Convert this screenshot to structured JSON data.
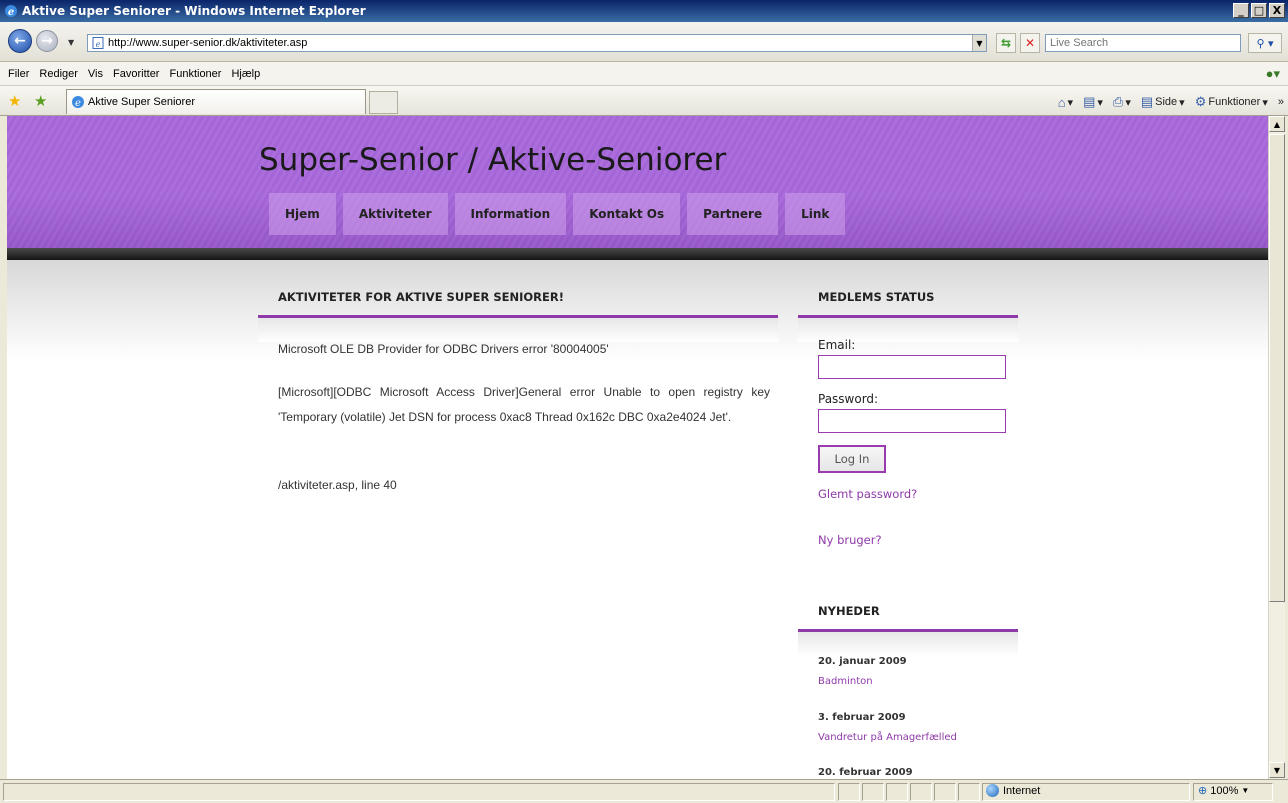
{
  "window": {
    "title": "Aktive Super Seniorer - Windows Internet Explorer",
    "minimize": "_",
    "maximize": "□",
    "close": "X"
  },
  "address": {
    "url": "http://www.super-senior.dk/aktiviteter.asp",
    "search_placeholder": "Live Search"
  },
  "menu": [
    "Filer",
    "Rediger",
    "Vis",
    "Favoritter",
    "Funktioner",
    "Hjælp"
  ],
  "tab": {
    "label": "Aktive Super Seniorer"
  },
  "toolbar": {
    "page_label": "Side",
    "tools_label": "Funktioner"
  },
  "site": {
    "title": "Super-Senior / Aktive-Seniorer",
    "nav": [
      "Hjem",
      "Aktiviteter",
      "Information",
      "Kontakt Os",
      "Partnere",
      "Link"
    ]
  },
  "main": {
    "heading": "AKTIVITETER FOR AKTIVE SUPER SENIORER!",
    "error_title": "Microsoft OLE DB Provider for ODBC Drivers error '80004005'",
    "error_detail": "[Microsoft][ODBC Microsoft Access Driver]General error Unable to open registry key 'Temporary (volatile) Jet DSN for process 0xac8 Thread 0x162c DBC 0xa2e4024 Jet'.",
    "error_location": "/aktiviteter.asp, line 40"
  },
  "sidebar": {
    "status_heading": "MEDLEMS STATUS",
    "email_label": "Email:",
    "password_label": "Password:",
    "login_button": "Log In",
    "forgot_link": "Glemt password?",
    "new_user_link": "Ny bruger?",
    "news_heading": "NYHEDER",
    "news": [
      {
        "date": "20. januar 2009",
        "title": "Badminton"
      },
      {
        "date": "3. februar 2009",
        "title": "Vandretur på Amagerfælled"
      },
      {
        "date": "20. februar 2009",
        "title": ""
      }
    ]
  },
  "status": {
    "zone": "Internet",
    "zoom": "100%"
  },
  "colors": {
    "accent": "#8e3aa8",
    "header": "#a465d6"
  }
}
